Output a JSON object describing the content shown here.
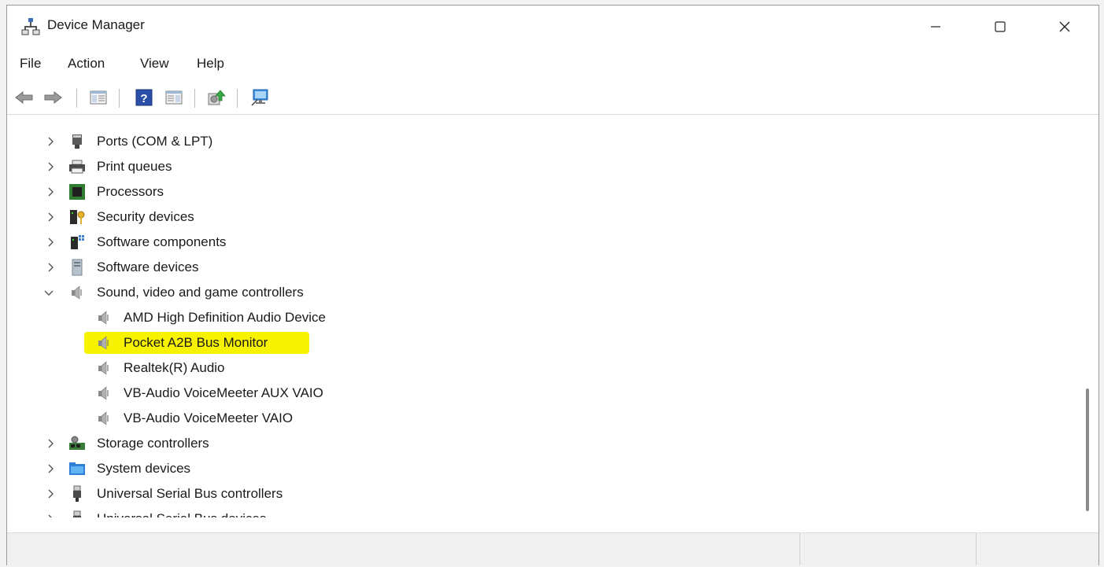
{
  "window": {
    "title": "Device Manager"
  },
  "menu": {
    "items": [
      "File",
      "Action",
      "View",
      "Help"
    ]
  },
  "toolbar": {
    "buttons": [
      "back-icon",
      "forward-icon",
      "show-hide-console-tree-icon",
      "help-icon",
      "show-hide-action-pane-icon",
      "update-driver-icon",
      "scan-hardware-icon"
    ]
  },
  "tree": {
    "items": [
      {
        "label": "Ports (COM & LPT)",
        "icon": "port-icon",
        "expanded": false,
        "level": 0
      },
      {
        "label": "Print queues",
        "icon": "printer-icon",
        "expanded": false,
        "level": 0
      },
      {
        "label": "Processors",
        "icon": "processor-icon",
        "expanded": false,
        "level": 0
      },
      {
        "label": "Security devices",
        "icon": "security-key-icon",
        "expanded": false,
        "level": 0
      },
      {
        "label": "Software components",
        "icon": "software-component-icon",
        "expanded": false,
        "level": 0
      },
      {
        "label": "Software devices",
        "icon": "software-device-icon",
        "expanded": false,
        "level": 0
      },
      {
        "label": "Sound, video and game controllers",
        "icon": "speaker-icon",
        "expanded": true,
        "level": 0
      },
      {
        "label": "AMD High Definition Audio Device",
        "icon": "speaker-icon",
        "level": 1
      },
      {
        "label": "Pocket A2B Bus Monitor",
        "icon": "speaker-icon",
        "level": 1,
        "highlighted": true
      },
      {
        "label": "Realtek(R) Audio",
        "icon": "speaker-icon",
        "level": 1
      },
      {
        "label": "VB-Audio VoiceMeeter AUX VAIO",
        "icon": "speaker-icon",
        "level": 1
      },
      {
        "label": "VB-Audio VoiceMeeter VAIO",
        "icon": "speaker-icon",
        "level": 1
      },
      {
        "label": "Storage controllers",
        "icon": "storage-controller-icon",
        "expanded": false,
        "level": 0
      },
      {
        "label": "System devices",
        "icon": "system-folder-icon",
        "expanded": false,
        "level": 0
      },
      {
        "label": "Universal Serial Bus controllers",
        "icon": "usb-icon",
        "expanded": false,
        "level": 0
      },
      {
        "label": "Universal Serial Bus devices",
        "icon": "usb-icon",
        "expanded": false,
        "level": 0
      }
    ]
  },
  "colors": {
    "highlight": "#f7f200",
    "selection_text": "#1a1a1a"
  }
}
